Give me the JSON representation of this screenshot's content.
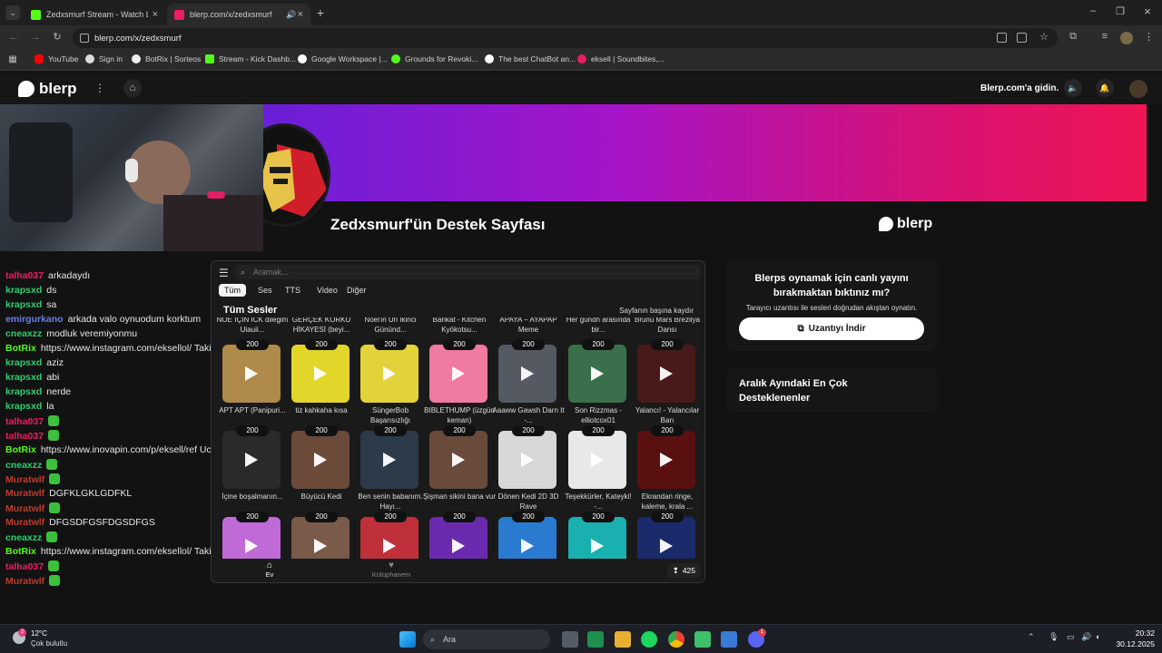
{
  "browser": {
    "tabs": [
      {
        "title": "Zedxsmurf Stream - Watch Live",
        "color": "#53fc18"
      },
      {
        "title": "blerp.com/x/zedxsmurf",
        "color": "#e91e63"
      }
    ],
    "url": "blerp.com/x/zedxsmurf",
    "bookmarks": [
      {
        "label": "YouTube",
        "color": "#ff0000"
      },
      {
        "label": "Sign in",
        "color": "#ffffff"
      },
      {
        "label": "BotRix | Sorteos",
        "color": "#ffffff"
      },
      {
        "label": "Stream - Kick Dashb...",
        "color": "#53fc18"
      },
      {
        "label": "Google Workspace |...",
        "color": "#ffffff"
      },
      {
        "label": "Grounds for Revoki...",
        "color": "#53fc18"
      },
      {
        "label": "The best ChatBot an...",
        "color": "#ffffff"
      },
      {
        "label": "eksell | Soundbites,...",
        "color": "#e91e63"
      }
    ]
  },
  "site": {
    "logo": "blerp",
    "go_link": "Blerp.com'a gidin.",
    "page_title": "Zedxsmurf'ün Destek Sayfası",
    "banner_logo": "blerp"
  },
  "chat": [
    {
      "user": "talha037",
      "color": "#e91e63",
      "text": "arkadaydı"
    },
    {
      "user": "krapsxd",
      "color": "#2ecc71",
      "text": "ds"
    },
    {
      "user": "krapsxd",
      "color": "#2ecc71",
      "text": "sa"
    },
    {
      "user": "emirgurkano",
      "color": "#6b7fe0",
      "text": "arkada valo oynuodum korktum"
    },
    {
      "user": "cneaxzz",
      "color": "#2ecc71",
      "text": "modluk veremiyonmu"
    },
    {
      "user": "BotRix",
      "color": "#53fc18",
      "text": "https://www.instagram.com/eksellol/ Takip etmeyi unutma"
    },
    {
      "user": "krapsxd",
      "color": "#2ecc71",
      "text": "aziz"
    },
    {
      "user": "krapsxd",
      "color": "#2ecc71",
      "text": "abi"
    },
    {
      "user": "krapsxd",
      "color": "#2ecc71",
      "text": "nerde"
    },
    {
      "user": "krapsxd",
      "color": "#2ecc71",
      "text": "la"
    },
    {
      "user": "talha037",
      "color": "#e91e63",
      "text": ""
    },
    {
      "user": "talha037",
      "color": "#e91e63",
      "text": ""
    },
    {
      "user": "BotRix",
      "color": "#53fc18",
      "text": "https://www.inovapin.com/p/eksell/ref Ucuz Pin için tıkla"
    },
    {
      "user": "cneaxzz",
      "color": "#2ecc71",
      "text": ""
    },
    {
      "user": "Muratwlf",
      "color": "#c0392b",
      "text": ""
    },
    {
      "user": "Muratwlf",
      "color": "#c0392b",
      "text": "DGFKLGKLGDFKL"
    },
    {
      "user": "Muratwlf",
      "color": "#c0392b",
      "text": ""
    },
    {
      "user": "Muratwlf",
      "color": "#c0392b",
      "text": "DFGSDFGSFDGSDFGS"
    },
    {
      "user": "cneaxzz",
      "color": "#2ecc71",
      "text": ""
    },
    {
      "user": "BotRix",
      "color": "#53fc18",
      "text": "https://www.instagram.com/eksellol/ Takip etmeyi unutma"
    },
    {
      "user": "talha037",
      "color": "#e91e63",
      "text": ""
    },
    {
      "user": "Muratwlf",
      "color": "#c0392b",
      "text": ""
    }
  ],
  "panel": {
    "search_placeholder": "Aramak...",
    "categories": [
      "Tüm",
      "Ses",
      "TTS",
      "Video",
      "Diğer"
    ],
    "section_title": "Tüm Sesler",
    "scroll_top": "Sayfanın başına kaydır",
    "partial_row": [
      "NOE İÇİN İCK dileğim Uiauii...",
      "GERÇEK KORKU HİKAYESİ (beyi...",
      "Noel'in Üri İkinci Gününd...",
      "Barikat - Kitchen Kyökotsu...",
      "APAYA – AYAPAP Meme",
      "Her gündn arasında bir...",
      "Brunu Mars Brezilya Dansı"
    ],
    "sounds": [
      {
        "price": "200",
        "title": "APT APT (Panipuri...",
        "color": "#b08a4a"
      },
      {
        "price": "200",
        "title": "tiz kahkaha kısa",
        "color": "#e3d62a"
      },
      {
        "price": "200",
        "title": "SüngerBob Başarısızlığı",
        "color": "#e4d23a"
      },
      {
        "price": "200",
        "title": "BIBLETHUMP (üzgün keman)",
        "color": "#f07aa0"
      },
      {
        "price": "200",
        "title": "Aaaww Gawsh Darn It -...",
        "color": "#555a62"
      },
      {
        "price": "200",
        "title": "Son Rizzmas - elliotcox01",
        "color": "#3a6f4b"
      },
      {
        "price": "200",
        "title": "Yalancı! - Yalancılar Barı",
        "color": "#4a1a1a"
      },
      {
        "price": "200",
        "title": "İçine boşalmanın...",
        "color": "#2a2a2a"
      },
      {
        "price": "200",
        "title": "Büyücü Kedi",
        "color": "#6b4a3a"
      },
      {
        "price": "200",
        "title": "Ben senin babanım. Hayı...",
        "color": "#2c3a4a"
      },
      {
        "price": "200",
        "title": "Şişman sikini bana vur",
        "color": "#6a4a3a"
      },
      {
        "price": "200",
        "title": "Dönen Kedi 2D 3D Rave",
        "color": "#d8d8d8"
      },
      {
        "price": "200",
        "title": "Teşekkürler, Kateyki! -...",
        "color": "#e8e8e8"
      },
      {
        "price": "200",
        "title": "Ekrandan ringe, kaleme, krala ...",
        "color": "#5a1010"
      },
      {
        "price": "200",
        "title": "",
        "color": "#c06ad8"
      },
      {
        "price": "200",
        "title": "",
        "color": "#7a5a4a"
      },
      {
        "price": "200",
        "title": "",
        "color": "#c0303a"
      },
      {
        "price": "200",
        "title": "",
        "color": "#6a2ab0"
      },
      {
        "price": "200",
        "title": "",
        "color": "#2a7ad0"
      },
      {
        "price": "200",
        "title": "",
        "color": "#1ab0b0"
      },
      {
        "price": "200",
        "title": "",
        "color": "#1a2a6a"
      }
    ],
    "nav_home": "Ev",
    "nav_library": "Kütüphanem",
    "points": "425"
  },
  "promo": {
    "title": "Blerps oynamak için canlı yayını bırakmaktan bıktınız mı?",
    "subtitle": "Tarayıcı uzantısı ile sesleri doğrudan akıştan oynatın.",
    "button": "Uzantıyı İndir"
  },
  "top_supporters": {
    "title": "Aralık Ayındaki En Çok Desteklenenler"
  },
  "taskbar": {
    "temp": "12°C",
    "weather": "Çok bulutlu",
    "weather_badge": "2",
    "search": "Ara",
    "time": "20:32",
    "date": "30.12.2025",
    "discord_badge": "1"
  }
}
